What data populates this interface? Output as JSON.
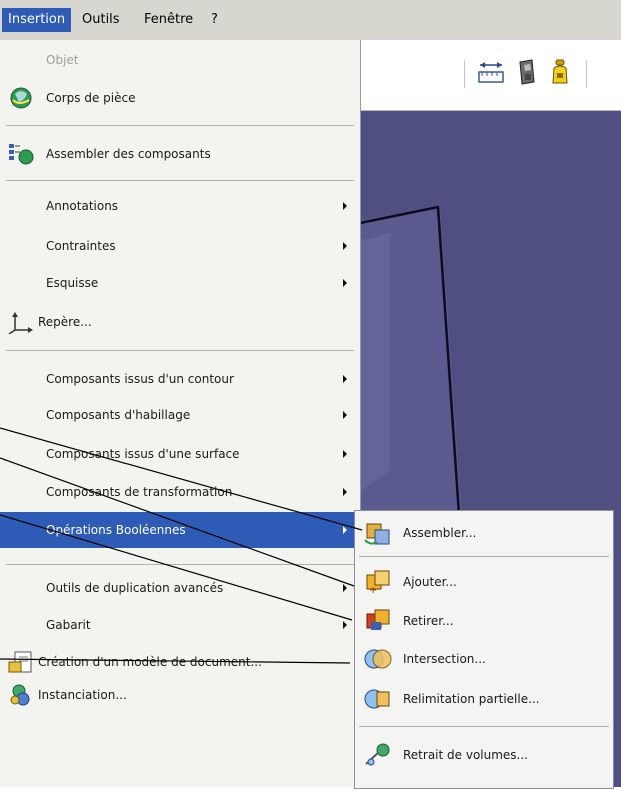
{
  "menubar": {
    "items": [
      {
        "label": "Insertion",
        "active": true
      },
      {
        "label": "Outils",
        "active": false
      },
      {
        "label": "Fenêtre",
        "active": false
      },
      {
        "label": "?",
        "active": false
      }
    ]
  },
  "menu": {
    "items": [
      {
        "label": "Objet",
        "disabled": true,
        "icon": "none"
      },
      {
        "label": "Corps de pièce",
        "icon": "part-body-icon"
      },
      {
        "label": "Assembler des composants",
        "icon": "assemble-components-icon"
      },
      {
        "label": "Annotations",
        "submenu": true
      },
      {
        "label": "Contraintes",
        "submenu": true
      },
      {
        "label": "Esquisse",
        "submenu": true
      },
      {
        "label": "Repère...",
        "icon": "axis-system-icon"
      },
      {
        "label": "Composants issus d'un contour",
        "submenu": true
      },
      {
        "label": "Composants d'habillage",
        "submenu": true
      },
      {
        "label": "Composants issus d'une surface",
        "submenu": true
      },
      {
        "label": "Composants de transformation",
        "submenu": true
      },
      {
        "label": "Opérations Booléennes",
        "submenu": true,
        "highlighted": true
      },
      {
        "label": "Outils de duplication avancés",
        "submenu": true
      },
      {
        "label": "Gabarit",
        "submenu": true
      },
      {
        "label": "Création d'un modèle de document...",
        "icon": "document-template-icon"
      },
      {
        "label": "Instanciation...",
        "icon": "instantiation-icon"
      }
    ]
  },
  "submenu": {
    "items": [
      {
        "label": "Assembler...",
        "icon": "assemble-icon"
      },
      {
        "label": "Ajouter...",
        "icon": "add-icon"
      },
      {
        "label": "Retirer...",
        "icon": "remove-icon"
      },
      {
        "label": "Intersection...",
        "icon": "intersection-icon"
      },
      {
        "label": "Relimitation partielle...",
        "icon": "partial-trim-icon"
      },
      {
        "label": "Retrait de volumes...",
        "icon": "remove-lump-icon"
      }
    ]
  },
  "colors": {
    "highlight": "#2d5bb5",
    "viewport": "#4f4f81",
    "menu_bg": "#f3f3ef"
  }
}
